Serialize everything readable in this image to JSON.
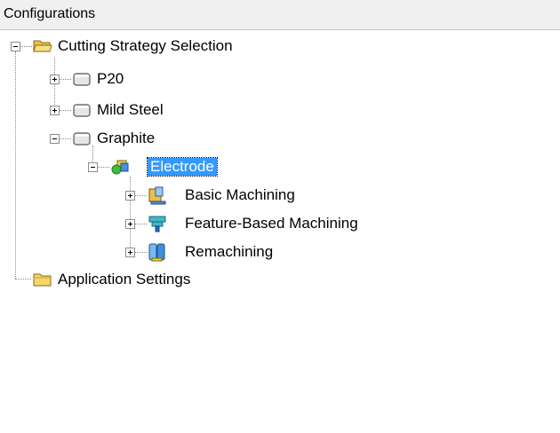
{
  "panel": {
    "title": "Configurations"
  },
  "tree": {
    "root": {
      "label": "Cutting Strategy Selection",
      "expanded": true,
      "icon": "folder-open-icon"
    },
    "materials": [
      {
        "label": "P20",
        "expanded": false,
        "icon": "material-box-icon"
      },
      {
        "label": "Mild Steel",
        "expanded": false,
        "icon": "material-box-icon"
      },
      {
        "label": "Graphite",
        "expanded": true,
        "icon": "material-box-icon"
      }
    ],
    "electrode": {
      "label": "Electrode",
      "selected": true,
      "icon": "electrode-icon"
    },
    "machining": [
      {
        "label": "Basic Machining",
        "icon": "basic-machining-icon"
      },
      {
        "label": "Feature-Based Machining",
        "icon": "feature-machining-icon"
      },
      {
        "label": "Remachining",
        "icon": "remachining-icon"
      }
    ],
    "app_settings": {
      "label": "Application Settings",
      "icon": "folder-closed-icon"
    }
  },
  "colors": {
    "selection": "#3399ff",
    "header_bg": "#f0f0f0",
    "folder": "#f5d76e"
  }
}
